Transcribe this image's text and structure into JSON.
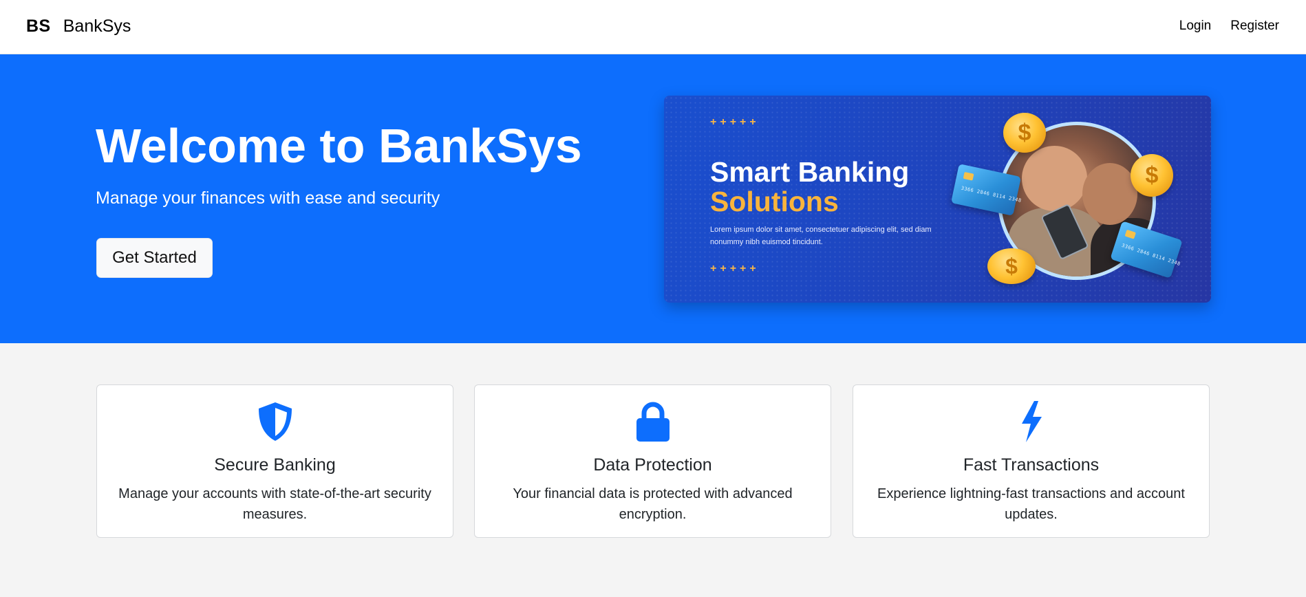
{
  "navbar": {
    "brand_logo": "BS",
    "brand_name": "BankSys",
    "links": [
      {
        "label": "Login"
      },
      {
        "label": "Register"
      }
    ]
  },
  "hero": {
    "title": "Welcome to BankSys",
    "subtitle": "Manage your finances with ease and security",
    "cta_label": "Get Started",
    "background_color": "#0d6efd",
    "banner": {
      "stars": "+++++",
      "headline_line1": "Smart Banking",
      "headline_line2": "Solutions",
      "body": "Lorem ipsum dolor sit amet, consectetuer adipiscing elit, sed diam nonummy nibh euismod tincidunt.",
      "coin_symbol": "$",
      "card_number_1": "3366 2846 8114 2348",
      "card_number_2": "3366 2846 8114 2348"
    }
  },
  "features": [
    {
      "icon": "shield-icon",
      "title": "Secure Banking",
      "description": "Manage your accounts with state-of-the-art security measures."
    },
    {
      "icon": "lock-icon",
      "title": "Data Protection",
      "description": "Your financial data is protected with advanced encryption."
    },
    {
      "icon": "lightning-bolt-icon",
      "title": "Fast Transactions",
      "description": "Experience lightning-fast transactions and account updates."
    }
  ],
  "colors": {
    "accent": "#0d6efd",
    "page_background": "#f4f4f4",
    "banner_highlight": "#f9b43d"
  }
}
